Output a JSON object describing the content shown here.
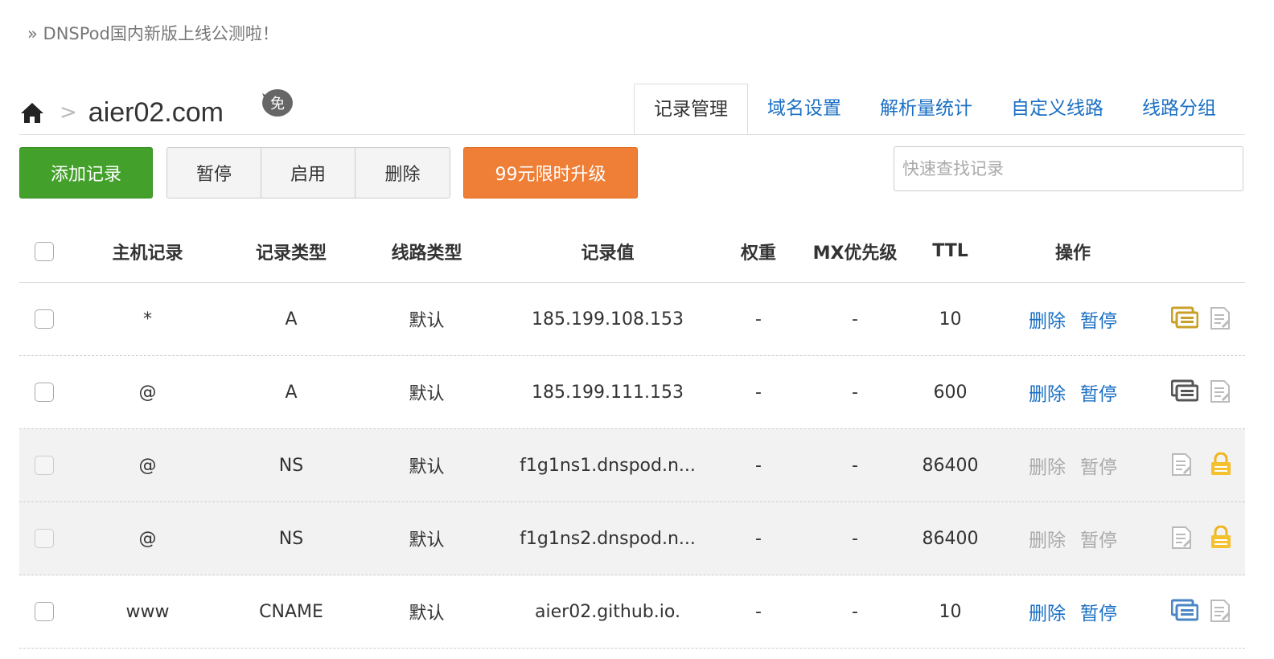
{
  "notice": "» DNSPod国内新版上线公测啦！",
  "header": {
    "domain": "aier02.com",
    "breadcrumb_sep": ">",
    "free_badge": "免"
  },
  "tabs": [
    {
      "label": "记录管理",
      "active": true
    },
    {
      "label": "域名设置",
      "active": false
    },
    {
      "label": "解析量统计",
      "active": false
    },
    {
      "label": "自定义线路",
      "active": false
    },
    {
      "label": "线路分组",
      "active": false
    }
  ],
  "toolbar": {
    "add_label": "添加记录",
    "pause_label": "暂停",
    "enable_label": "启用",
    "delete_label": "删除",
    "upgrade_label": "99元限时升级",
    "search_placeholder": "快速查找记录"
  },
  "colors": {
    "add_green": "#43a02a",
    "upgrade_orange": "#ef7e36",
    "link_blue": "#1a6fc4",
    "locked_row_bg": "#f2f2f2"
  },
  "table": {
    "headers": {
      "host": "主机记录",
      "type": "记录类型",
      "line": "线路类型",
      "value": "记录值",
      "weight": "权重",
      "mx": "MX优先级",
      "ttl": "TTL",
      "ops": "操作"
    },
    "rows": [
      {
        "host": "*",
        "type": "A",
        "line": "默认",
        "value": "185.199.108.153",
        "weight": "-",
        "mx": "-",
        "ttl": "10",
        "op_delete": "删除",
        "op_pause": "暂停",
        "locked": false,
        "icons": [
          "remark-icon-gold",
          "note-icon"
        ]
      },
      {
        "host": "@",
        "type": "A",
        "line": "默认",
        "value": "185.199.111.153",
        "weight": "-",
        "mx": "-",
        "ttl": "600",
        "op_delete": "删除",
        "op_pause": "暂停",
        "locked": false,
        "icons": [
          "remark-icon-dark",
          "note-icon"
        ]
      },
      {
        "host": "@",
        "type": "NS",
        "line": "默认",
        "value": "f1g1ns1.dnspod.n...",
        "weight": "-",
        "mx": "-",
        "ttl": "86400",
        "op_delete": "删除",
        "op_pause": "暂停",
        "locked": true,
        "icons": [
          "note-icon",
          "lock-icon"
        ]
      },
      {
        "host": "@",
        "type": "NS",
        "line": "默认",
        "value": "f1g1ns2.dnspod.n...",
        "weight": "-",
        "mx": "-",
        "ttl": "86400",
        "op_delete": "删除",
        "op_pause": "暂停",
        "locked": true,
        "icons": [
          "note-icon",
          "lock-icon"
        ]
      },
      {
        "host": "www",
        "type": "CNAME",
        "line": "默认",
        "value": "aier02.github.io.",
        "weight": "-",
        "mx": "-",
        "ttl": "10",
        "op_delete": "删除",
        "op_pause": "暂停",
        "locked": false,
        "icons": [
          "remark-icon-blue",
          "note-icon"
        ]
      }
    ]
  }
}
